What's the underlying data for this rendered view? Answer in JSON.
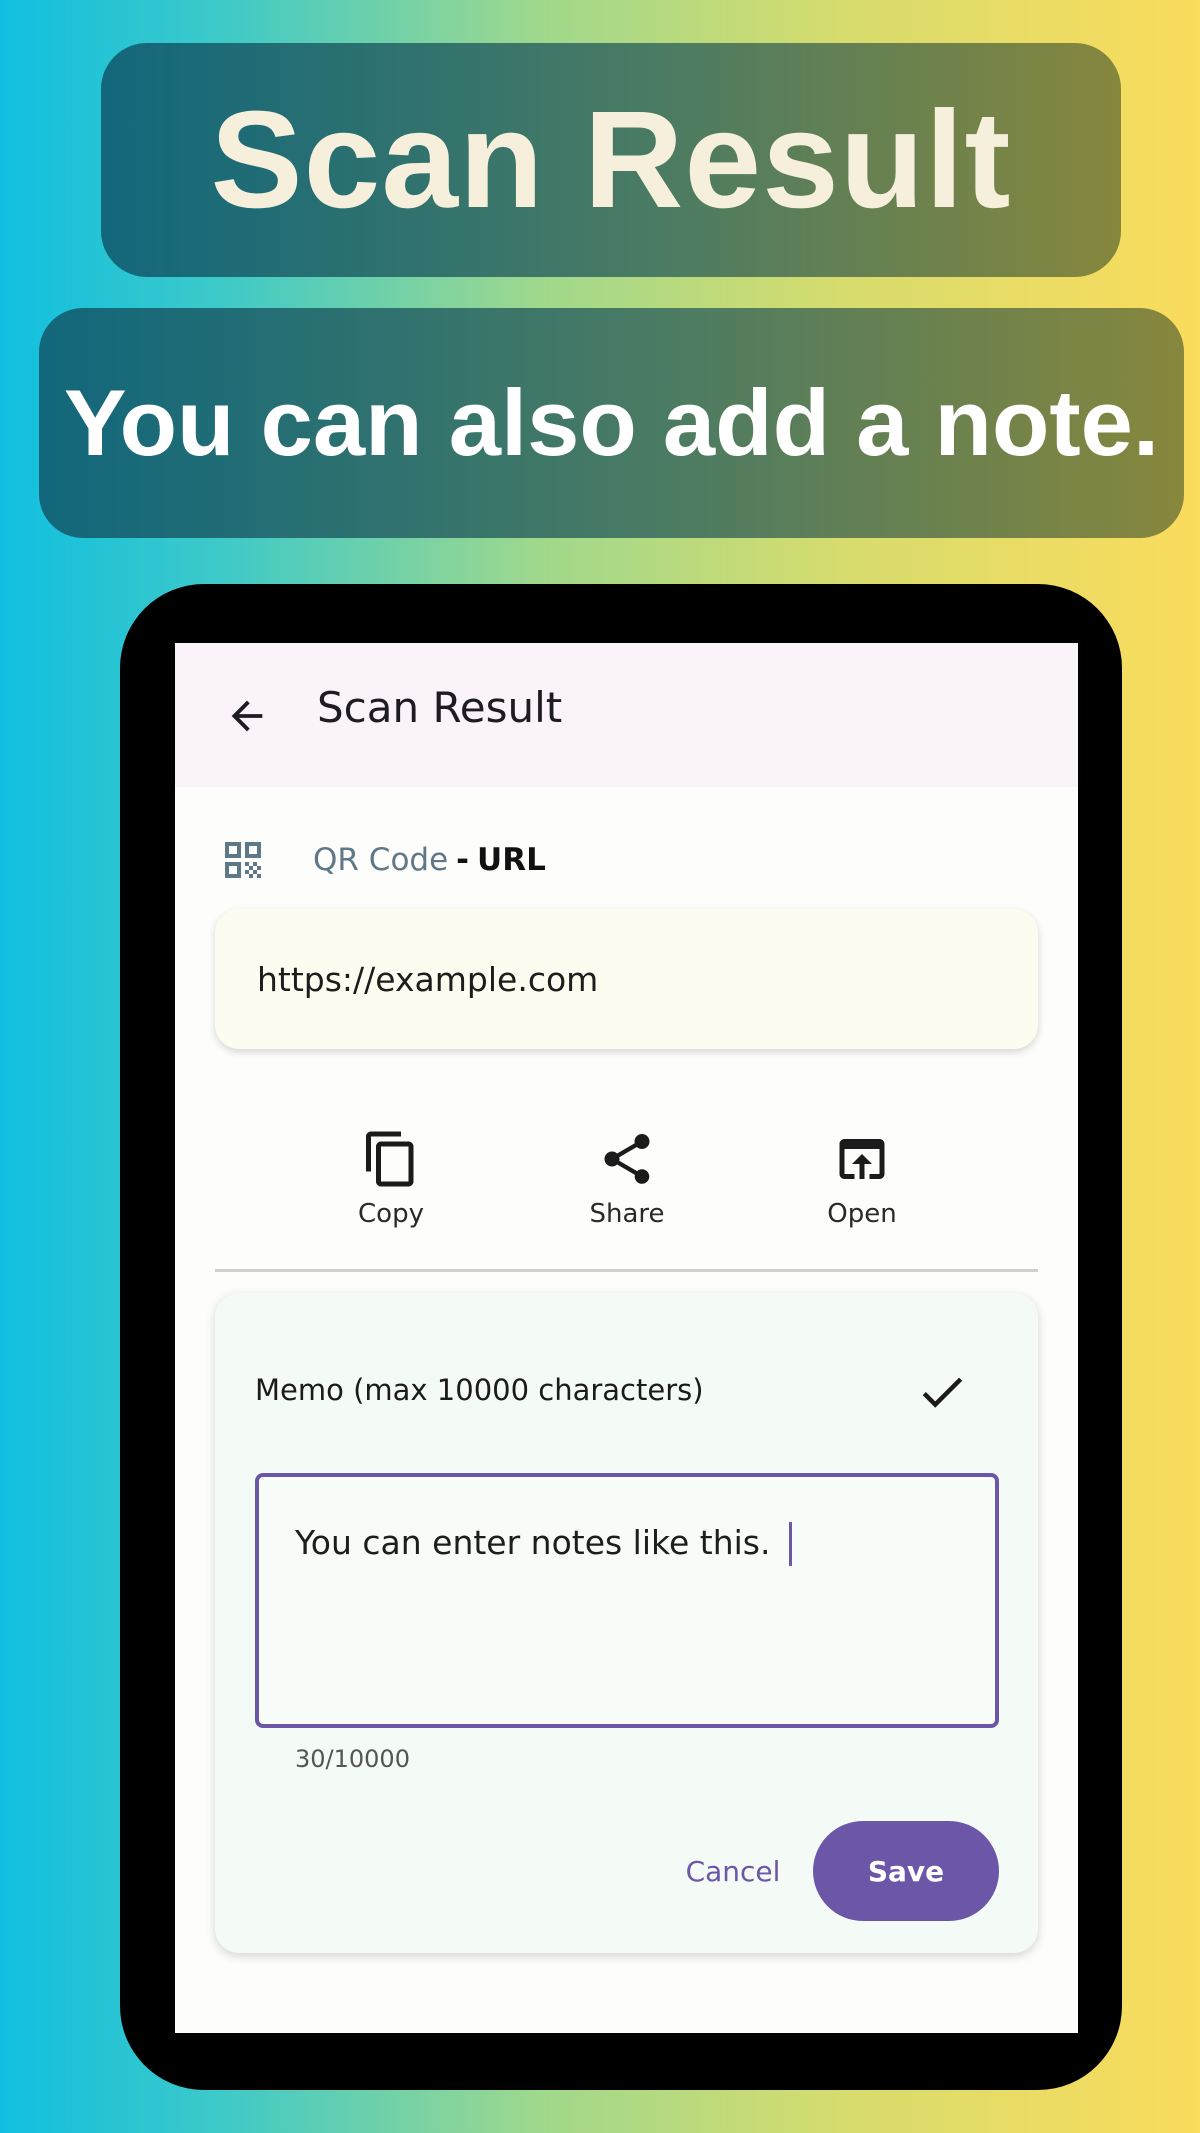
{
  "banners": {
    "title": "Scan Result",
    "subtitle": "You can also add a note."
  },
  "appbar": {
    "title": "Scan Result",
    "back_icon": "arrow-left-icon"
  },
  "result": {
    "type_icon": "qr-code-icon",
    "format": "QR Code",
    "separator": "-",
    "content_type": "URL",
    "content": "https://example.com"
  },
  "actions": [
    {
      "label": "Copy",
      "icon": "copy-icon"
    },
    {
      "label": "Share",
      "icon": "share-icon"
    },
    {
      "label": "Open",
      "icon": "open-in-browser-icon"
    }
  ],
  "memo": {
    "title": "Memo (max 10000 characters)",
    "value": "You can enter notes like this.",
    "char_count": "30/10000",
    "confirm_icon": "check-icon",
    "cancel_label": "Cancel",
    "save_label": "Save"
  },
  "colors": {
    "accent": "#6b56a8",
    "appbar_bg": "#faf3fa",
    "url_card_bg": "#fdfcf0",
    "memo_card_bg": "#f4faf6"
  }
}
